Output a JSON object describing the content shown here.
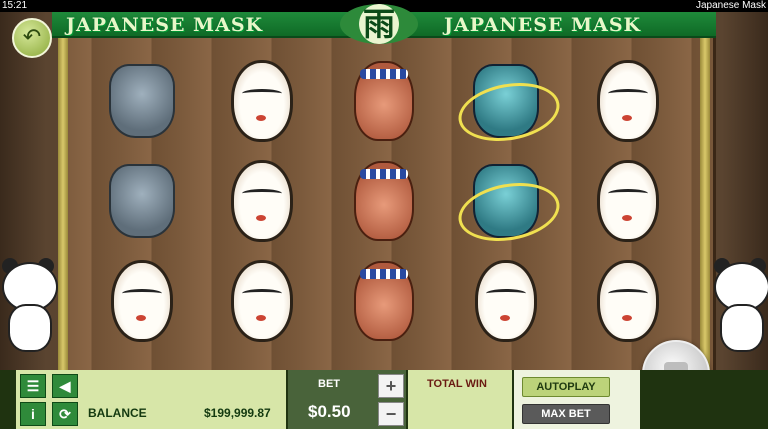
{
  "status": {
    "time": "15:21",
    "app_title": "Japanese Mask"
  },
  "banner": {
    "left_title": "JAPANESE MASK",
    "right_title": "JAPANESE MASK",
    "logo_glyph": "雨"
  },
  "back_button": {
    "icon": "back-arrow-icon",
    "glyph": "↶"
  },
  "reels": [
    [
      "demon-mask-grey",
      "demon-mask-grey",
      "white-woman-mask"
    ],
    [
      "white-woman-mask",
      "white-woman-mask",
      "white-woman-mask"
    ],
    [
      "old-man-mask",
      "old-man-mask",
      "old-man-mask"
    ],
    [
      "demon-mask-blue",
      "demon-mask-blue",
      "white-woman-mask"
    ],
    [
      "white-woman-mask",
      "white-woman-mask",
      "white-woman-mask"
    ]
  ],
  "panel": {
    "menu_icon": "list-icon",
    "sound_icon": "speaker-icon",
    "info_glyph": "i",
    "refresh_icon": "refresh-icon",
    "balance_label": "BALANCE",
    "balance_value": "$199,999.87",
    "bet_label": "BET",
    "bet_value": "$0.50",
    "plus": "+",
    "minus": "−",
    "total_win_label": "TOTAL WIN",
    "autoplay_label": "AUTOPLAY",
    "maxbet_label": "MAX BET"
  },
  "colors": {
    "banner": "#1f8a3a",
    "panel": "#d7e6a8",
    "bet_panel": "#49633a"
  }
}
